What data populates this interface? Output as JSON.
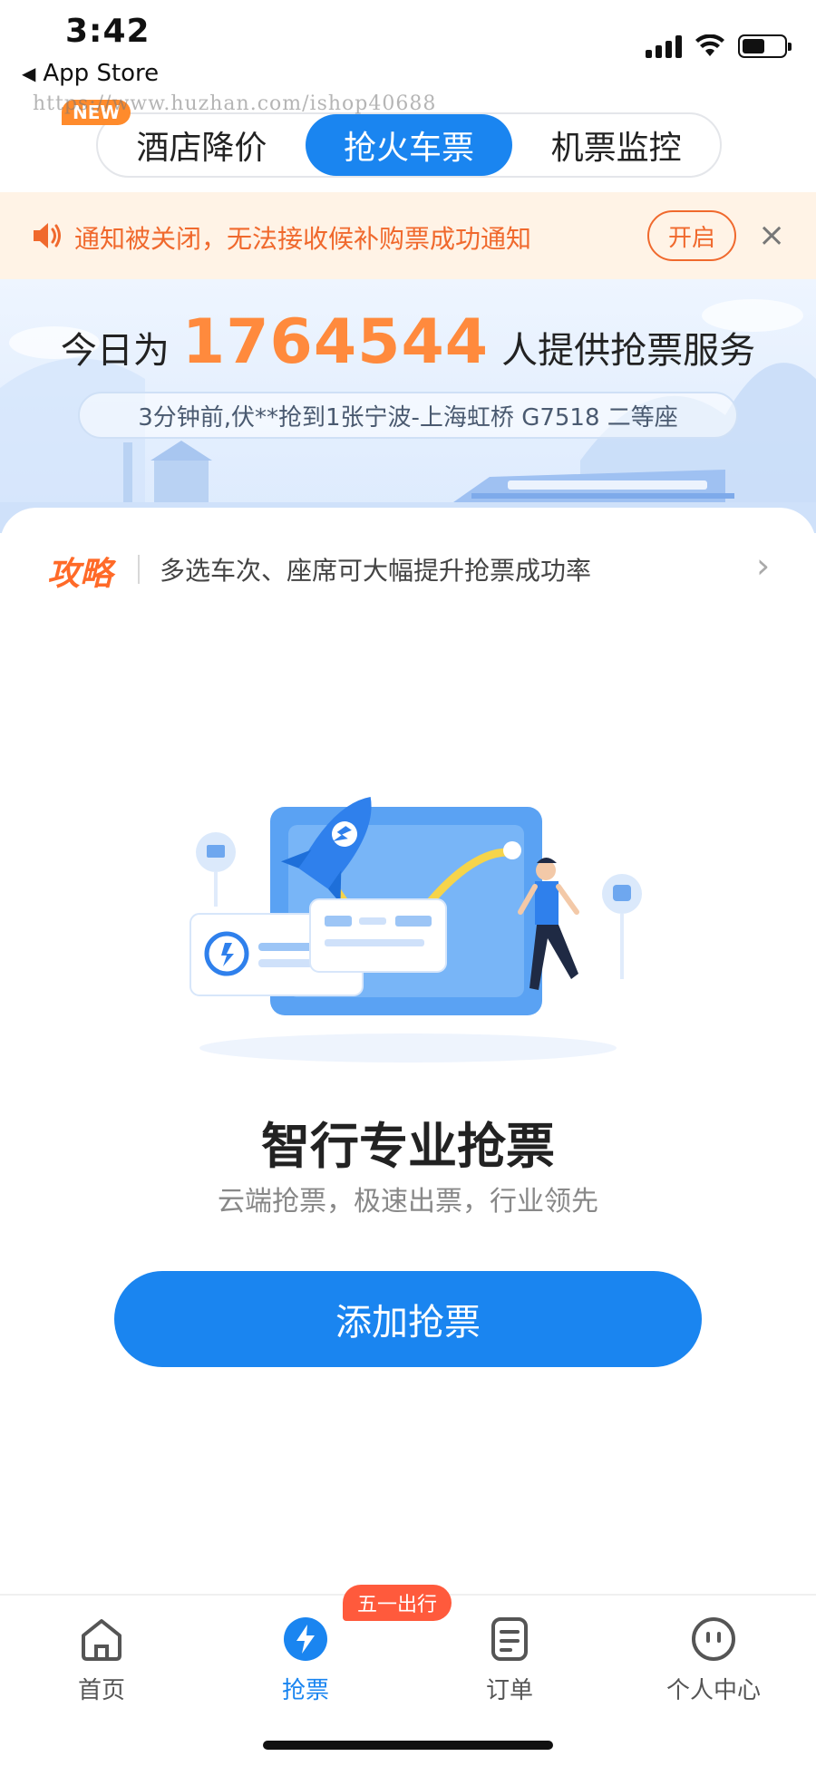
{
  "status_bar": {
    "time": "3:42",
    "back_app": "App Store",
    "watermark": "https://www.huzhan.com/ishop40688"
  },
  "top_tabs": {
    "new_badge": "NEW",
    "items": [
      {
        "label": "酒店降价",
        "active": false
      },
      {
        "label": "抢火车票",
        "active": true
      },
      {
        "label": "机票监控",
        "active": false
      }
    ]
  },
  "notice": {
    "icon": "speaker-icon",
    "message": "通知被关闭，无法接收候补购票成功通知",
    "open_label": "开启",
    "close_label": "×"
  },
  "hero": {
    "prefix": "今日为",
    "count": "1764544",
    "suffix": "人提供抢票服务",
    "ticker": "3分钟前,伏**抢到1张宁波-上海虹桥 G7518 二等座"
  },
  "tip": {
    "tag": "攻略",
    "text": "多选车次、座席可大幅提升抢票成功率",
    "chevron": "›"
  },
  "main": {
    "headline": "智行专业抢票",
    "subline": "云端抢票，极速出票，行业领先",
    "cta_label": "添加抢票"
  },
  "bottom_nav": {
    "badge": "五一出行",
    "items": [
      {
        "label": "首页",
        "icon": "home-icon",
        "active": false
      },
      {
        "label": "抢票",
        "icon": "lightning-icon",
        "active": true
      },
      {
        "label": "订单",
        "icon": "order-icon",
        "active": false
      },
      {
        "label": "个人中心",
        "icon": "profile-icon",
        "active": false
      }
    ]
  },
  "colors": {
    "primary": "#1a85f0",
    "orange": "#ff8a3d",
    "notice_text": "#f0692d",
    "notice_bg": "#fff3e6"
  }
}
